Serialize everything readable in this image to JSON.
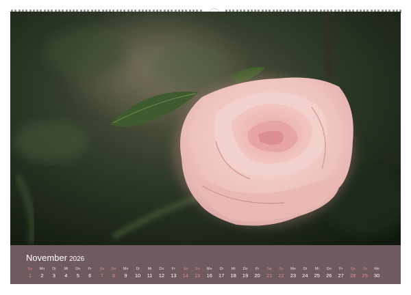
{
  "calendar": {
    "month": "November",
    "year": "2026",
    "days": [
      {
        "wd": "So",
        "n": "1",
        "weekend": true
      },
      {
        "wd": "Mo",
        "n": "2",
        "weekend": false
      },
      {
        "wd": "Di",
        "n": "3",
        "weekend": false
      },
      {
        "wd": "Mi",
        "n": "4",
        "weekend": false
      },
      {
        "wd": "Do",
        "n": "5",
        "weekend": false
      },
      {
        "wd": "Fr",
        "n": "6",
        "weekend": false
      },
      {
        "wd": "Sa",
        "n": "7",
        "weekend": true
      },
      {
        "wd": "So",
        "n": "8",
        "weekend": true
      },
      {
        "wd": "Mo",
        "n": "9",
        "weekend": false
      },
      {
        "wd": "Di",
        "n": "10",
        "weekend": false
      },
      {
        "wd": "Mi",
        "n": "11",
        "weekend": false
      },
      {
        "wd": "Do",
        "n": "12",
        "weekend": false
      },
      {
        "wd": "Fr",
        "n": "13",
        "weekend": false
      },
      {
        "wd": "Sa",
        "n": "14",
        "weekend": true
      },
      {
        "wd": "So",
        "n": "15",
        "weekend": true
      },
      {
        "wd": "Mo",
        "n": "16",
        "weekend": false
      },
      {
        "wd": "Di",
        "n": "17",
        "weekend": false
      },
      {
        "wd": "Mi",
        "n": "18",
        "weekend": false
      },
      {
        "wd": "Do",
        "n": "19",
        "weekend": false
      },
      {
        "wd": "Fr",
        "n": "20",
        "weekend": false
      },
      {
        "wd": "Sa",
        "n": "21",
        "weekend": true
      },
      {
        "wd": "So",
        "n": "22",
        "weekend": true
      },
      {
        "wd": "Mo",
        "n": "23",
        "weekend": false
      },
      {
        "wd": "Di",
        "n": "24",
        "weekend": false
      },
      {
        "wd": "Mi",
        "n": "25",
        "weekend": false
      },
      {
        "wd": "Do",
        "n": "26",
        "weekend": false
      },
      {
        "wd": "Fr",
        "n": "27",
        "weekend": false
      },
      {
        "wd": "Sa",
        "n": "28",
        "weekend": true
      },
      {
        "wd": "So",
        "n": "29",
        "weekend": true
      },
      {
        "wd": "Mo",
        "n": "30",
        "weekend": false
      }
    ]
  },
  "photo": {
    "subject": "rose-icon"
  },
  "colors": {
    "strip": "#6f5a5f",
    "weekend": "#d98c92",
    "text": "#ffffff"
  }
}
